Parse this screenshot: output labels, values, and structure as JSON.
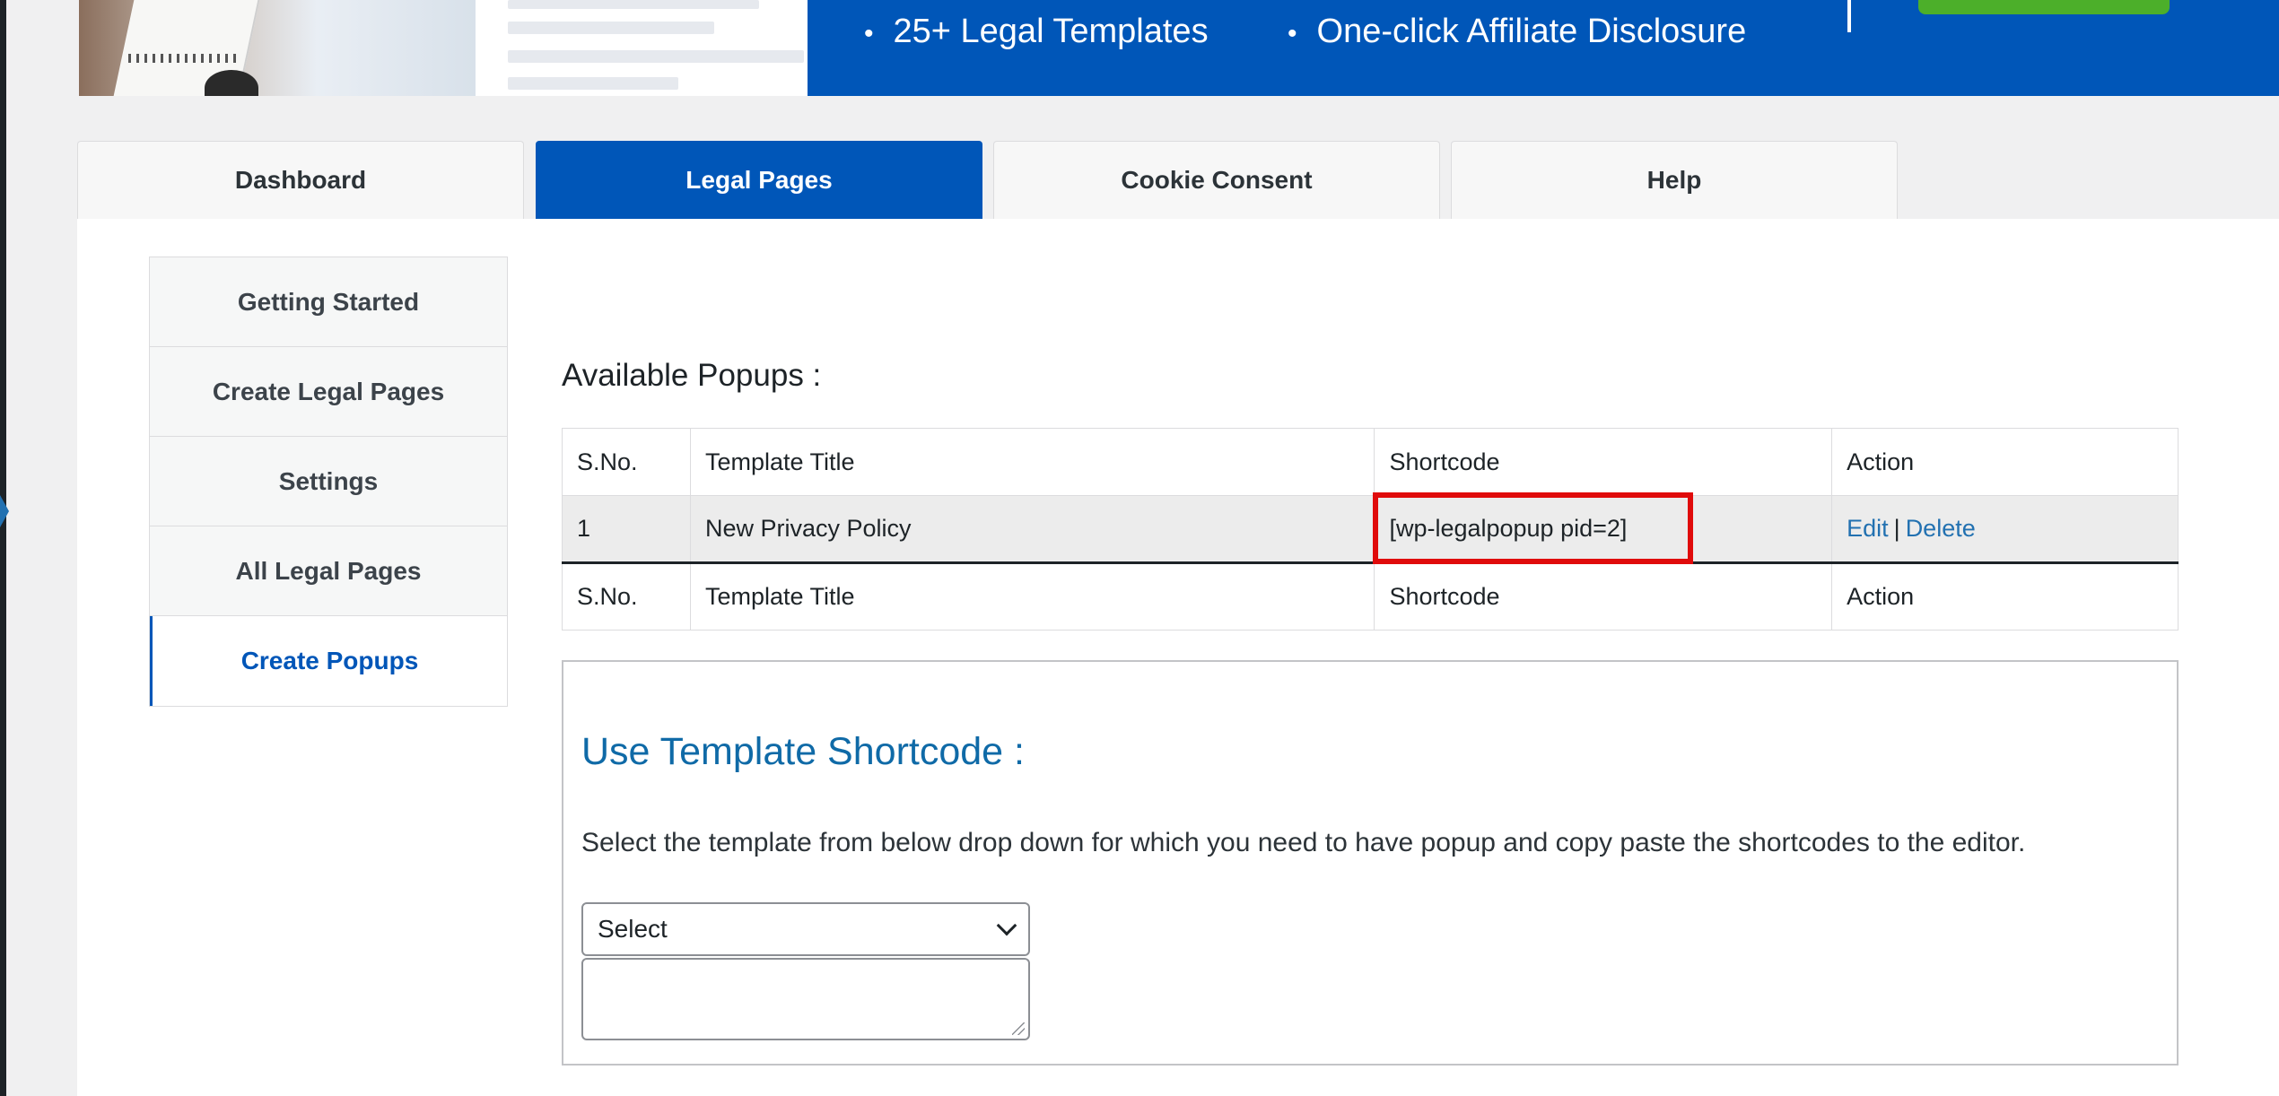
{
  "banner": {
    "features": [
      "25+ Legal Templates",
      "One-click Affiliate Disclosure"
    ],
    "bullet": "•"
  },
  "tabs": [
    {
      "label": "Dashboard",
      "active": false
    },
    {
      "label": "Legal Pages",
      "active": true
    },
    {
      "label": "Cookie Consent",
      "active": false
    },
    {
      "label": "Help",
      "active": false
    }
  ],
  "sidebar": {
    "items": [
      {
        "label": "Getting Started"
      },
      {
        "label": "Create Legal Pages"
      },
      {
        "label": "Settings"
      },
      {
        "label": "All Legal Pages"
      },
      {
        "label": "Create Popups",
        "active": true
      }
    ]
  },
  "popups": {
    "title": "Available Popups :",
    "headers": [
      "S.No.",
      "Template Title",
      "Shortcode",
      "Action"
    ],
    "rows": [
      {
        "sno": "1",
        "title": "New Privacy Policy",
        "shortcode": "[wp-legalpopup pid=2]",
        "edit": "Edit",
        "delete": "Delete",
        "separator": "|"
      }
    ],
    "footers": [
      "S.No.",
      "Template Title",
      "Shortcode",
      "Action"
    ]
  },
  "shortcode_section": {
    "title": "Use Template Shortcode :",
    "description": "Select the template from below drop down for which you need to have popup and copy paste the shortcodes to the editor.",
    "select_value": "Select",
    "textarea_value": ""
  },
  "colors": {
    "brand_blue": "#0056b8",
    "link_blue": "#2271b1",
    "highlight_red": "#e00b0b",
    "title_blue": "#0f6aa7"
  }
}
